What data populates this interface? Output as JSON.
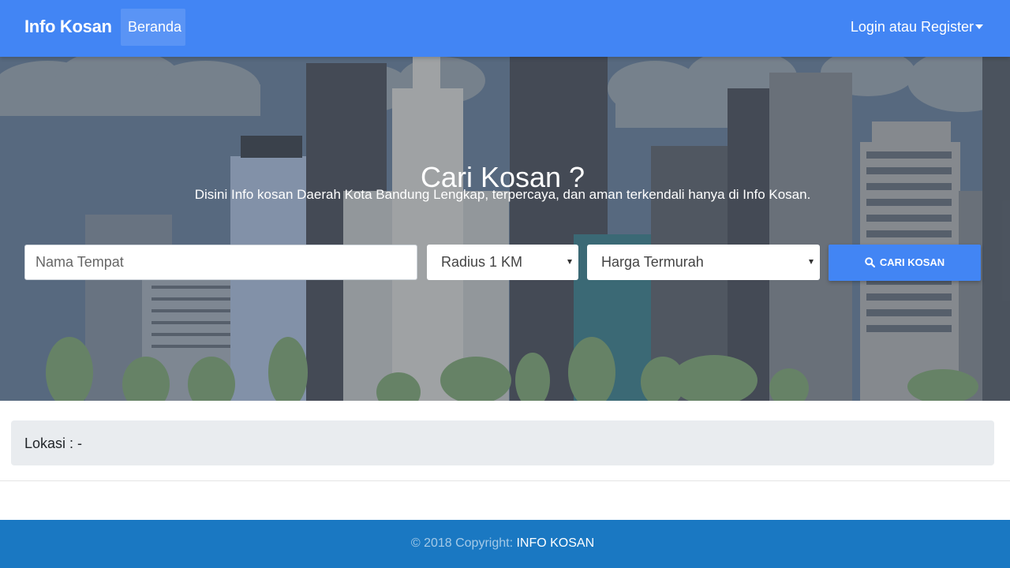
{
  "navbar": {
    "brand": "Info Kosan",
    "nav_item": "Beranda",
    "login": "Login atau Register"
  },
  "hero": {
    "title": "Cari Kosan ?",
    "subtitle": "Disini Info kosan Daerah Kota Bandung Lengkap, terpercaya, dan aman terkendali hanya di Info Kosan."
  },
  "search": {
    "placeholder": "Nama Tempat",
    "radius_selected": "Radius 1 KM",
    "sort_selected": "Harga Termurah",
    "button_label": "CARI KOSAN",
    "button_icon": "search-icon"
  },
  "lokasi": {
    "label": "Lokasi : -"
  },
  "footer": {
    "copyright": "© 2018 Copyright: ",
    "link": "INFO KOSAN"
  },
  "colors": {
    "primary": "#4285f4",
    "footer": "#1a78c2",
    "hero_sky": "#5c6f86"
  }
}
